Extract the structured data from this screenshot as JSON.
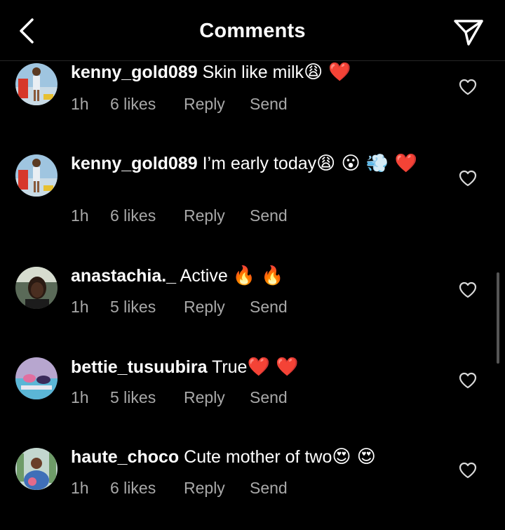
{
  "header": {
    "title": "Comments",
    "back_icon": "chevron-left-icon",
    "share_icon": "paper-plane-icon"
  },
  "comments": [
    {
      "username": "kenny_gold089",
      "text": " Skin like milk",
      "emojis": "😩 ❤️",
      "time": "1h",
      "likes": "6 likes",
      "reply": "Reply",
      "send": "Send"
    },
    {
      "username": "kenny_gold089",
      "text": " I’m early today",
      "emojis": "😩 😮 💨 ❤️",
      "time": "1h",
      "likes": "6 likes",
      "reply": "Reply",
      "send": "Send"
    },
    {
      "username": "anastachia._",
      "text": " Active",
      "emojis": "🔥 🔥",
      "time": "1h",
      "likes": "5 likes",
      "reply": "Reply",
      "send": "Send"
    },
    {
      "username": "bettie_tusuubira",
      "text": " True",
      "emojis": "❤️ ❤️",
      "time": "1h",
      "likes": "5 likes",
      "reply": "Reply",
      "send": "Send"
    },
    {
      "username": "haute_choco",
      "text": " Cute mother of two",
      "emojis": "😍 😍",
      "time": "1h",
      "likes": "6 likes",
      "reply": "Reply",
      "send": "Send"
    }
  ]
}
